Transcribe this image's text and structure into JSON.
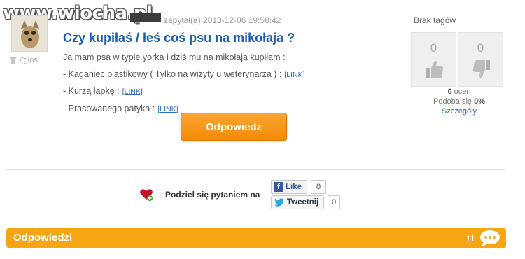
{
  "watermark": "www.wiocha.pl",
  "question": {
    "meta": "zapytał(a) 2013-12-06 19:58:42",
    "title": "Czy kupiłaś / łeś coś psu na mikołaja ?",
    "lines": [
      {
        "text": "Ja mam psa w typie yorka i dziś mu na mikołaja kupiłam :",
        "link": ""
      },
      {
        "text": "- Kaganiec plastikowy ( Tylko na wizyty u weterynarza )  :",
        "link": "[LINK]"
      },
      {
        "text": "- Kurzą łapkę :",
        "link": "[LINK]"
      },
      {
        "text": "- Prasowanego patyka :",
        "link": "[LINK]"
      }
    ],
    "report_label": "Zgłoś",
    "answer_button": "Odpowiedz"
  },
  "sidebar": {
    "tags": "Brak tagów",
    "votes_up": "0",
    "votes_down": "0",
    "ratings_count": "0",
    "ratings_label": "ocen",
    "liked_label": "Podoba się",
    "liked_value": "0%",
    "details": "Szczegóły"
  },
  "share": {
    "label": "Podziel się pytaniem na",
    "like_label": "Like",
    "like_count": "0",
    "tweet_label": "Tweetnij",
    "tweet_count": "0"
  },
  "answers": {
    "title": "Odpowiedzi",
    "count": "11"
  },
  "colors": {
    "accent": "#f7a613",
    "title_blue": "#1b5db0",
    "link_blue": "#2a6cc4"
  }
}
